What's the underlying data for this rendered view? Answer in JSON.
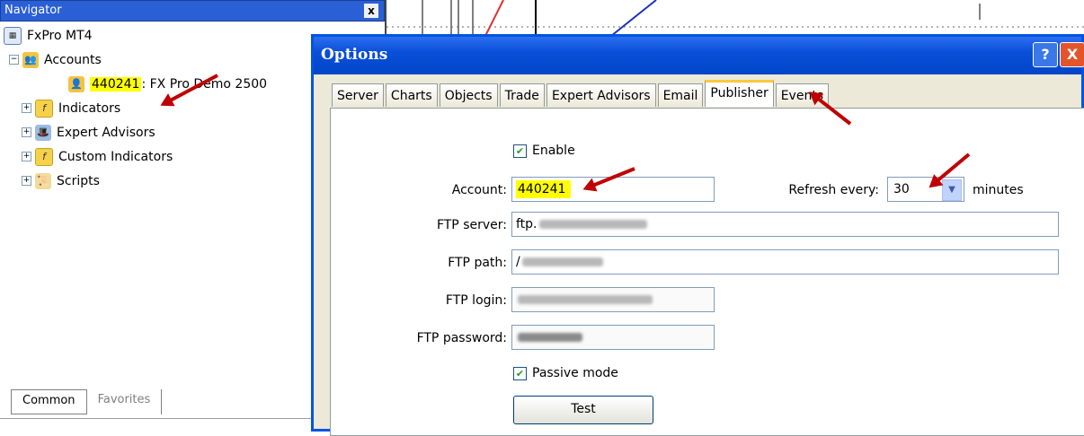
{
  "navigator": {
    "title": "Navigator",
    "close_label": "x",
    "tree": {
      "root": "FxPro MT4",
      "accounts": "Accounts",
      "account_number": "440241",
      "account_name": ": FX Pro Demo 2500",
      "indicators": "Indicators",
      "expert_advisors": "Expert Advisors",
      "custom_indicators": "Custom Indicators",
      "scripts": "Scripts"
    },
    "tabs": [
      "Common",
      "Favorites"
    ]
  },
  "options_dialog": {
    "title": "Options",
    "help_label": "?",
    "close_label": "X",
    "tabs": [
      "Server",
      "Charts",
      "Objects",
      "Trade",
      "Expert Advisors",
      "Email",
      "Publisher",
      "Events"
    ],
    "active_tab": "Publisher",
    "publisher": {
      "enable_label": "Enable",
      "enable_checked": true,
      "account_label": "Account:",
      "account_value": "440241",
      "refresh_label": "Refresh every:",
      "refresh_value": "30",
      "refresh_unit": "minutes",
      "ftp_server_label": "FTP server:",
      "ftp_server_value": "ftp.",
      "ftp_path_label": "FTP path:",
      "ftp_path_value": "/",
      "ftp_login_label": "FTP login:",
      "ftp_password_label": "FTP password:",
      "passive_mode_label": "Passive mode",
      "passive_mode_checked": true,
      "test_label": "Test"
    }
  },
  "colors": {
    "highlight": "#ffff00",
    "xp_blue": "#0054e3",
    "arrow_red": "#c00000"
  }
}
